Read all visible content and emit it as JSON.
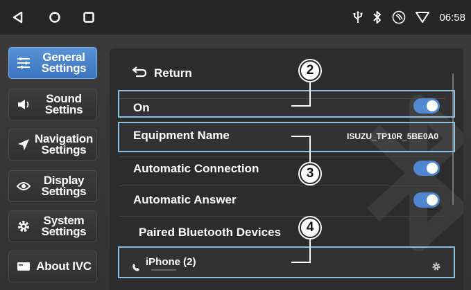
{
  "statusbar": {
    "nav_icons": [
      "back-icon",
      "home-icon",
      "recents-icon"
    ],
    "status_icons": [
      "usb-icon",
      "bluetooth-icon",
      "phone-link-icon",
      "wifi-icon"
    ],
    "time": "06:58"
  },
  "sidebar": {
    "items": [
      {
        "label": "General Settings",
        "icon": "sliders-icon",
        "active": true
      },
      {
        "label": "Sound Settins",
        "icon": "speaker-icon",
        "active": false
      },
      {
        "label": "Navigation Settings",
        "icon": "navigation-arrow-icon",
        "active": false
      },
      {
        "label": "Display Settings",
        "icon": "eye-icon",
        "active": false
      },
      {
        "label": "System Settings",
        "icon": "gear-icon",
        "active": false
      },
      {
        "label": "About IVC",
        "icon": "card-icon",
        "active": false
      }
    ]
  },
  "content": {
    "return_label": "Return",
    "bluetooth_label": "On",
    "bluetooth_on": true,
    "equipment_name_label": "Equipment Name",
    "equipment_name_value": "ISUZU_TP10R_5BE0A0",
    "auto_connection_label": "Automatic Connection",
    "auto_connection_on": true,
    "auto_answer_label": "Automatic Answer",
    "auto_answer_on": true,
    "paired_devices_label": "Paired Bluetooth Devices",
    "devices": [
      {
        "name": "iPhone (2)",
        "icon": "phone-icon",
        "action_icon": "gear-icon"
      }
    ]
  },
  "callouts": [
    "2",
    "3",
    "4"
  ],
  "colors": {
    "accent": "#4f86d1",
    "highlight_border": "#8cbfe0",
    "active_tab": "#4a82cc"
  }
}
